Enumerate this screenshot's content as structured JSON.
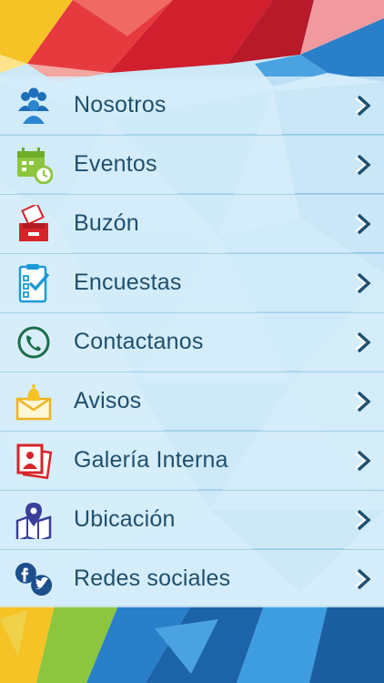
{
  "menu": {
    "items": [
      {
        "label": "Nosotros",
        "icon": "group-icon"
      },
      {
        "label": "Eventos",
        "icon": "calendar-icon"
      },
      {
        "label": "Buzón",
        "icon": "mailbox-icon"
      },
      {
        "label": "Encuestas",
        "icon": "survey-icon"
      },
      {
        "label": "Contactanos",
        "icon": "phone-icon"
      },
      {
        "label": "Avisos",
        "icon": "bell-envelope-icon"
      },
      {
        "label": "Galería Interna",
        "icon": "gallery-icon"
      },
      {
        "label": "Ubicación",
        "icon": "map-pin-icon"
      },
      {
        "label": "Redes sociales",
        "icon": "social-icon"
      }
    ]
  },
  "colors": {
    "text": "#1f4f6e",
    "row_bg": "#d7eefa",
    "accent_red": "#d8232a",
    "accent_blue": "#1c7ec2",
    "accent_green": "#8cc63f",
    "accent_yellow": "#f6c326"
  }
}
